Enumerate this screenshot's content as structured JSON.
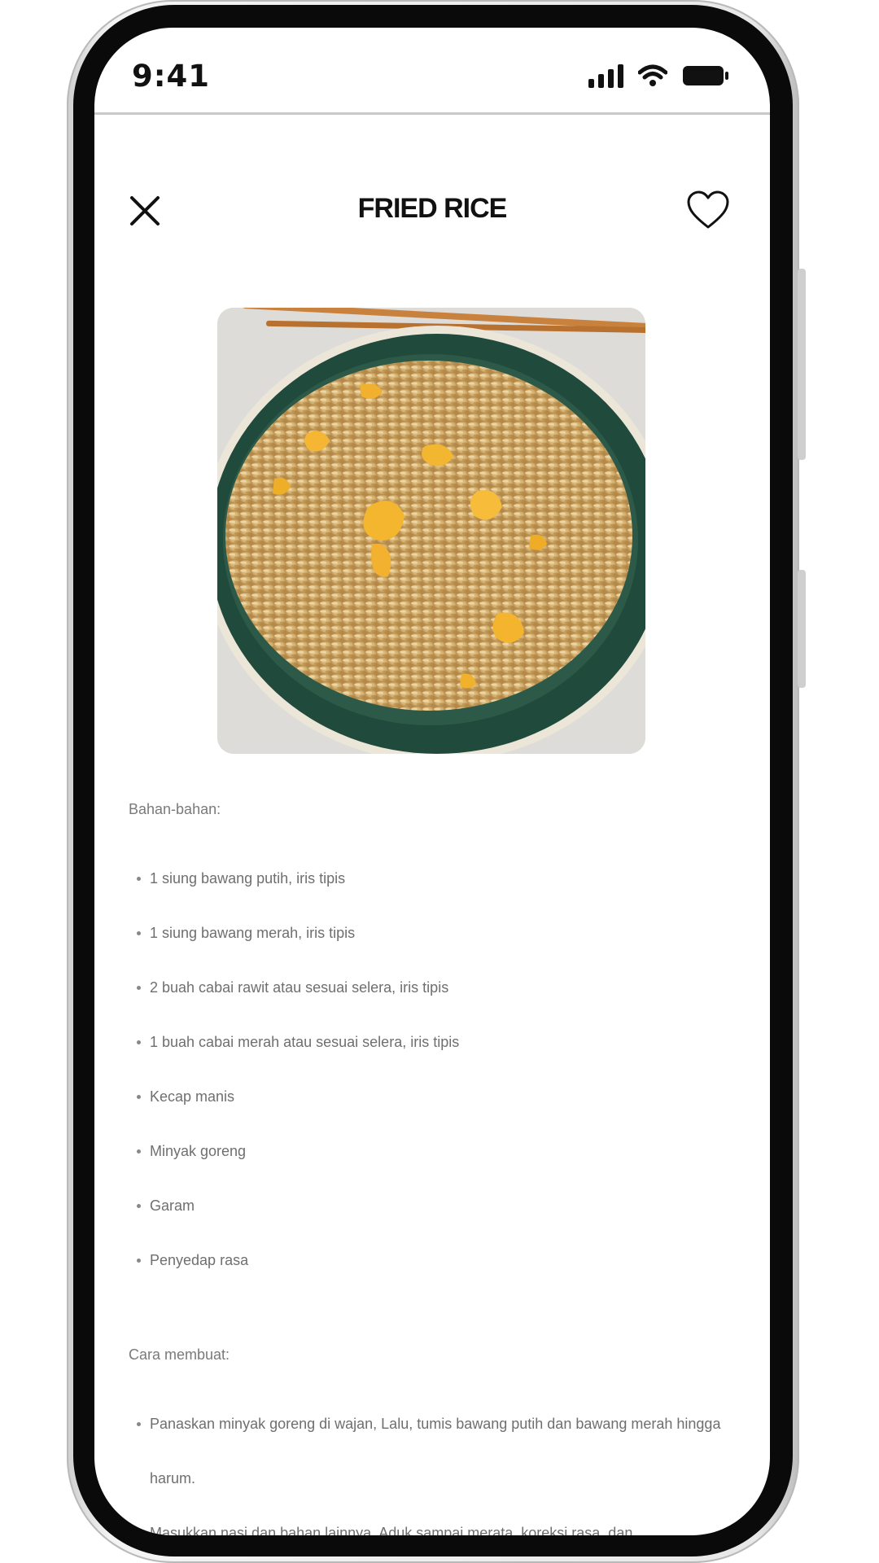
{
  "status_bar": {
    "time": "9:41",
    "icons": [
      "signal-icon",
      "wifi-icon",
      "battery-icon"
    ]
  },
  "header": {
    "title": "FRIED RICE",
    "close_icon": "close-icon",
    "favorite_icon": "heart-icon"
  },
  "image": {
    "subject": "fried-rice-photo"
  },
  "ingredients": {
    "heading": "Bahan-bahan:",
    "items": [
      "1 siung bawang putih, iris tipis",
      "1 siung bawang merah, iris tipis",
      "2 buah cabai rawit atau sesuai selera, iris tipis",
      "1 buah cabai merah atau sesuai selera, iris tipis",
      "Kecap manis",
      "Minyak goreng",
      "Garam",
      "Penyedap rasa"
    ]
  },
  "steps": {
    "heading": "Cara membuat:",
    "items": [
      "Panaskan minyak goreng di wajan, Lalu, tumis bawang putih dan bawang merah hingga harum.",
      "Masukkan nasi dan bahan lainnya. Aduk sampai merata, koreksi rasa, dan"
    ]
  },
  "colors": {
    "text_primary": "#111111",
    "text_secondary": "#777777",
    "divider": "#c9c9c9"
  }
}
